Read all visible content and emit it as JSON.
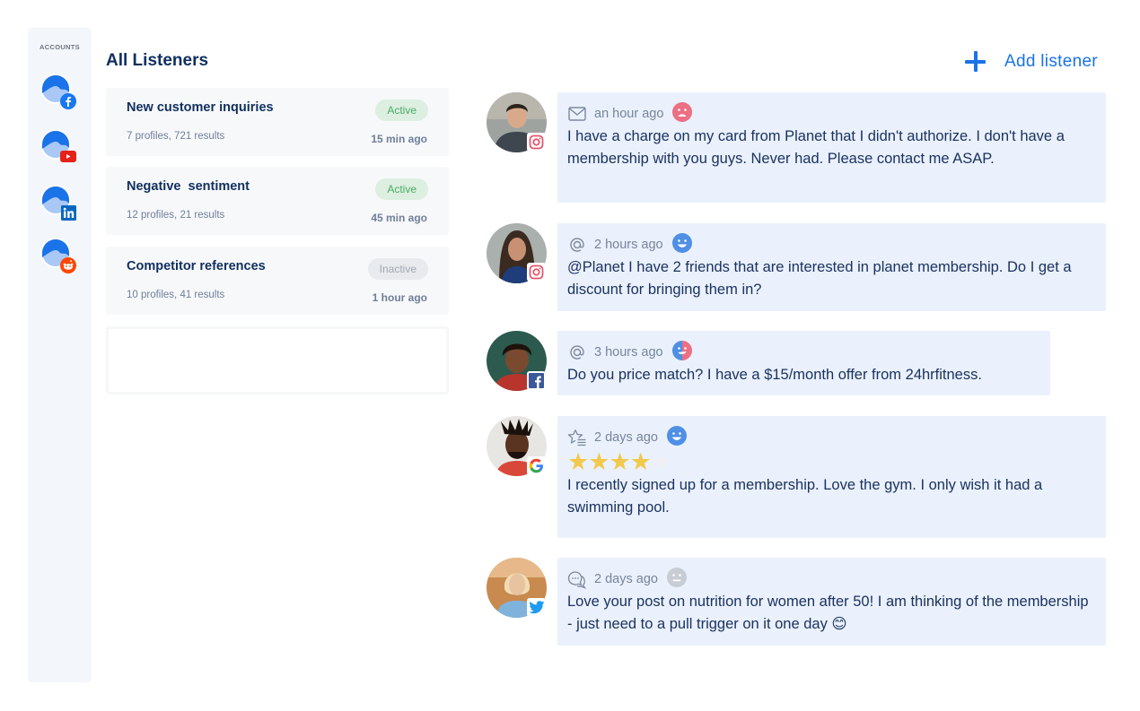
{
  "sidebar": {
    "title": "ACCOUNTS",
    "accounts": [
      {
        "network": "facebook",
        "icon": "facebook-icon",
        "color": "#1877f2"
      },
      {
        "network": "youtube",
        "icon": "youtube-icon",
        "color": "#ff0000"
      },
      {
        "network": "linkedin",
        "icon": "linkedin-icon",
        "color": "#0a66c2"
      },
      {
        "network": "reddit",
        "icon": "reddit-icon",
        "color": "#ff4500"
      }
    ]
  },
  "header": {
    "title": "All Listeners",
    "add_label": "Add listener",
    "accent": "#1a73e8"
  },
  "listeners": [
    {
      "name": "New customer inquiries",
      "status": "Active",
      "meta": "7 profiles, 721 results",
      "ago": "15 min ago"
    },
    {
      "name": "Negative  sentiment",
      "status": "Active",
      "meta": "12 profiles, 21 results",
      "ago": "45 min ago"
    },
    {
      "name": "Competitor references",
      "status": "Inactive",
      "meta": "10 profiles, 41 results",
      "ago": "1 hour ago"
    }
  ],
  "feed": [
    {
      "network": "instagram",
      "type_icon": "mail-icon",
      "time": "an hour ago",
      "sentiment": "negative",
      "text": "I have a charge on my card from Planet that I didn't authorize. I don't have a membership with you guys. Never had. Please contact me ASAP."
    },
    {
      "network": "instagram",
      "type_icon": "mention-icon",
      "time": "2 hours ago",
      "sentiment": "positive",
      "text": "@Planet I have 2 friends that are interested in planet membership. Do I get a discount for bringing them in?"
    },
    {
      "network": "facebook",
      "type_icon": "mention-icon",
      "time": "3 hours ago",
      "sentiment": "mixed",
      "text": "Do you price match? I have a $15/month offer from 24hrfitness."
    },
    {
      "network": "google",
      "type_icon": "review-icon",
      "time": "2 days ago",
      "sentiment": "positive",
      "rating": 4,
      "rating_max": 5,
      "text": "I recently signed up for a membership. Love the gym. I only wish it had a swimming pool."
    },
    {
      "network": "twitter",
      "type_icon": "comment-icon",
      "time": "2 days ago",
      "sentiment": "neutral",
      "text": "Love your post on nutrition for women after 50! I am thinking of the membership - just need to a pull trigger on it one day 😊"
    }
  ],
  "colors": {
    "sentiment_negative": "#ec6f83",
    "sentiment_positive": "#4f8fe6",
    "sentiment_neutral": "#c8ccd4",
    "star_filled": "#f2c94c",
    "star_empty": "#eef0f3"
  }
}
